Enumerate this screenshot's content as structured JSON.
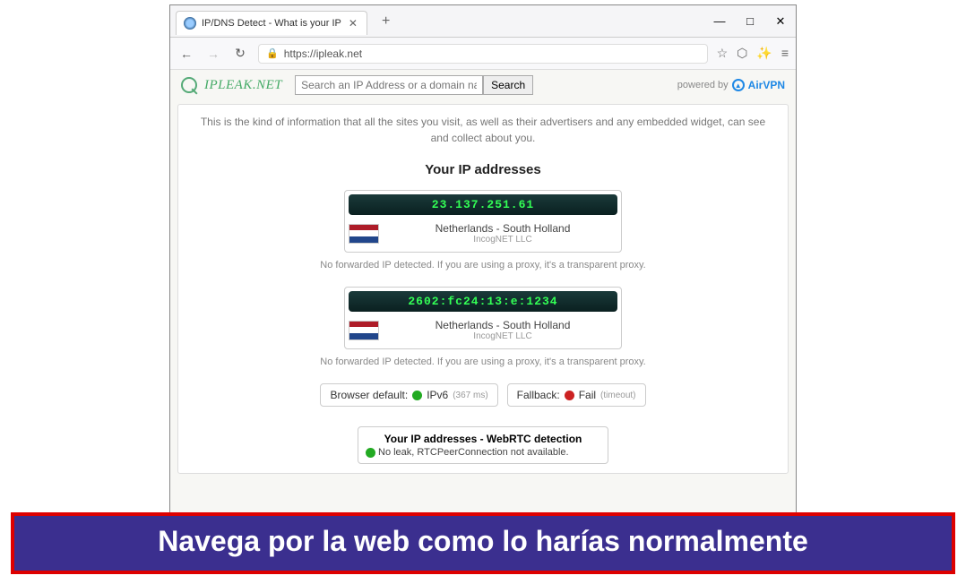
{
  "browser": {
    "tab_title": "IP/DNS Detect - What is your IP",
    "new_tab": "+",
    "window": {
      "min": "—",
      "max": "□",
      "close": "✕"
    },
    "nav": {
      "back": "←",
      "forward": "→",
      "reload": "↻"
    },
    "url": "https://ipleak.net",
    "addr_icons": {
      "star": "☆",
      "shield": "⬡",
      "spark": "✨",
      "menu": "≡"
    }
  },
  "site": {
    "logo": "IPLEAK.NET",
    "search_placeholder": "Search an IP Address or a domain nam",
    "search_btn": "Search",
    "powered_label": "powered by",
    "powered_brand": "AirVPN"
  },
  "intro": "This is the kind of information that all the sites you visit, as well as their advertisers and any embedded widget, can see and collect about you.",
  "sections": {
    "ip_title": "Your IP addresses",
    "proxy_note": "No forwarded IP detected. If you are using a proxy, it's a transparent proxy."
  },
  "ips": [
    {
      "value": "23.137.251.61",
      "location": "Netherlands - South Holland",
      "org": "IncogNET LLC",
      "flag": "nl"
    },
    {
      "value": "2602:fc24:13:e:1234",
      "location": "Netherlands - South Holland",
      "org": "IncogNET LLC",
      "flag": "nl"
    }
  ],
  "status": {
    "default_label": "Browser default:",
    "default_value": "IPv6",
    "default_ms": "(367 ms)",
    "fallback_label": "Fallback:",
    "fallback_value": "Fail",
    "fallback_note": "(timeout)"
  },
  "webrtc": {
    "title": "Your IP addresses - WebRTC detection",
    "status": "No leak, RTCPeerConnection not available."
  },
  "banner": "Navega por la web como lo harías normalmente"
}
